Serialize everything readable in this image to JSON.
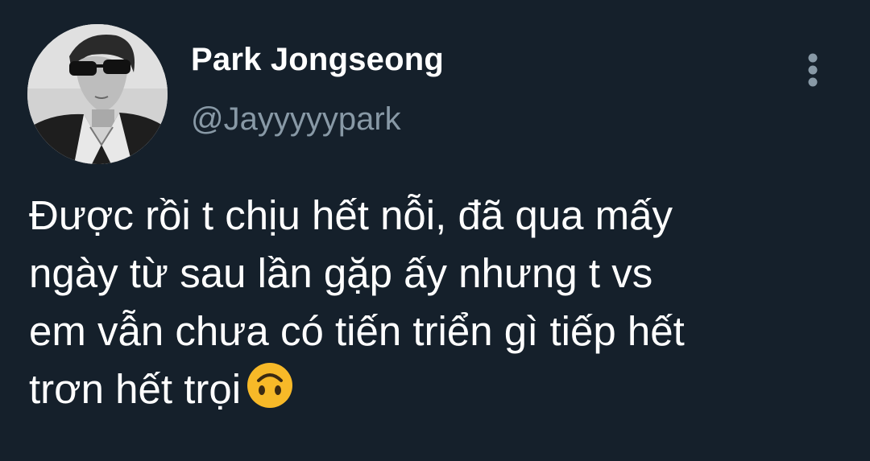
{
  "tweet": {
    "author": {
      "display_name": "Park Jongseong",
      "handle": "@Jayyyyypark"
    },
    "text_lines": [
      "Được rồi t chịu hết nỗi, đã qua mấy",
      "ngày từ sau lần gặp ấy nhưng t vs",
      "em vẫn chưa có tiến triển gì tiếp hết",
      "trơn hết trọi"
    ],
    "emoji": "upside-down-face",
    "more_icon": "more-vertical-icon"
  },
  "colors": {
    "background": "#15202b",
    "primary_text": "#ffffff",
    "secondary_text": "#8899a6",
    "emoji_yellow": "#f7b928"
  }
}
